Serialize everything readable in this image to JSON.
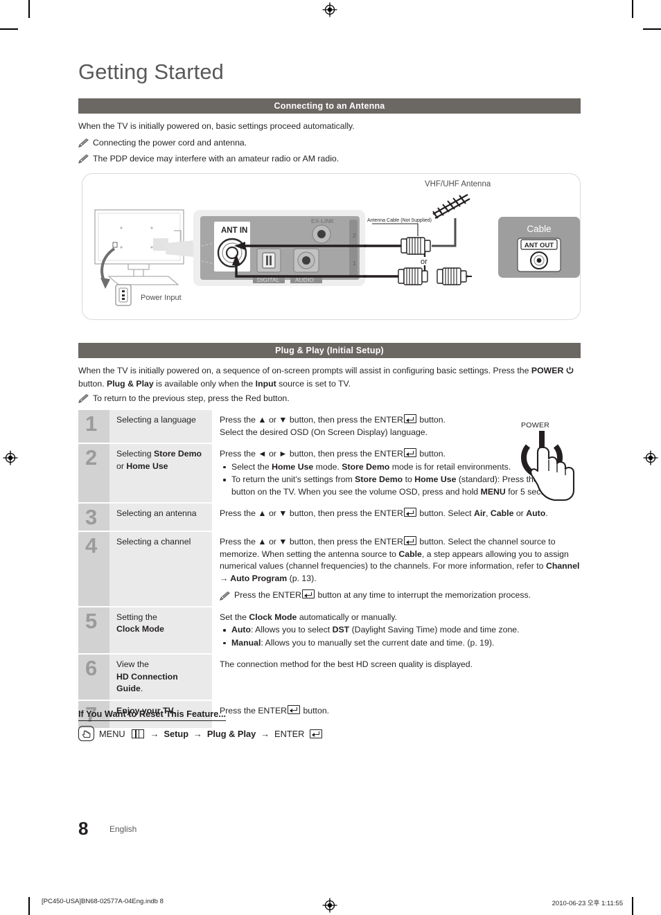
{
  "document": {
    "chapter_title": "Getting Started",
    "page_number": "8",
    "page_language": "English"
  },
  "sections": {
    "antenna": {
      "bar_title": "Connecting to an Antenna",
      "intro": "When the TV is initially powered on, basic settings proceed automatically.",
      "note_1": "Connecting the power cord and antenna.",
      "note_2": "The PDP device may interfere with an amateur radio or AM radio."
    },
    "plug_play": {
      "bar_title": "Plug & Play (Initial Setup)",
      "note": "To return to the previous step, press the Red button."
    }
  },
  "diagram": {
    "labels": {
      "vhf_uhf_antenna": "VHF/UHF Antenna",
      "antenna_cable": "Antenna Cable (Not Supplied)",
      "ant_in": "ANT IN",
      "ex_link": "EX-LINK",
      "digital": "DIGITAL",
      "audio": "AUDIO",
      "port_1": "1",
      "port_2": "2",
      "or": "or",
      "cable_box": "Cable",
      "ant_out": "ANT OUT",
      "power_input": "Power Input"
    }
  },
  "steps": [
    {
      "number": "1",
      "label_html": "Selecting a language",
      "desc_html": "Press the ▲ or ▼ button, then press the ENTER<span class=\"enterkey\"></span> button.<br>Select the desired OSD (On Screen Display) language."
    },
    {
      "number": "2",
      "label_html": "Selecting <b>Store Demo</b><br>or <b>Home Use</b>",
      "desc_html": "Press the ◄ or ► button, then press the ENTER<span class=\"enterkey\"></span> button.<ul class=\"bullets\"><li>Select the <b>Home Use</b> mode. <b>Store Demo</b> mode is for retail environments.</li><li>To return the unit’s settings from <b>Store Demo</b> to <b>Home Use</b> (standard): Press the volume button on the TV. When you see the volume OSD, press and hold <b>MENU</b> for 5 sec.</li></ul>"
    },
    {
      "number": "3",
      "label_html": "Selecting an antenna",
      "desc_html": "Press the ▲ or ▼ button, then press the ENTER<span class=\"enterkey\"></span> button. Select <b>Air</b>, <b>Cable</b> or <b>Auto</b>."
    },
    {
      "number": "4",
      "label_html": "Selecting a channel",
      "desc_html": "Press the ▲ or ▼ button, then press the ENTER<span class=\"enterkey\"></span> button. Select the channel source to memorize. When setting the antenna source to <b>Cable</b>, a step appears allowing you to assign numerical values (channel frequencies) to the channels. For more information, refer to <b>Channel → Auto Program</b> (p. 13).<div class=\"note-in\"><span class=\"pencil\"></span><span>Press the ENTER<span class=\"enterkey\"></span> button at any time to interrupt the memorization process.</span></div>"
    },
    {
      "number": "5",
      "label_html": "Setting the<br><b>Clock Mode</b>",
      "desc_html": "Set the <b>Clock Mode</b> automatically or manually.<ul class=\"bullets\"><li><b>Auto</b>: Allows you to select <b>DST</b> (Daylight Saving Time) mode and time zone.</li><li><b>Manual</b>: Allows you to manually set the current date and time. (p. 19).</li></ul>"
    },
    {
      "number": "6",
      "label_html": "View the<br><b>HD Connection Guide</b>.",
      "desc_html": "The connection method for the best HD screen quality is displayed."
    },
    {
      "number": "7",
      "label_html": "<b>Enjoy your TV.</b>",
      "desc_html": "Press the ENTER<span class=\"enterkey\"></span> button."
    }
  ],
  "power_figure": {
    "label": "POWER"
  },
  "reset": {
    "heading": "If You Want to Reset This Feature...",
    "path_menu": "MENU",
    "path_setup": "Setup",
    "path_plugplay": "Plug & Play",
    "path_enter": "ENTER",
    "arrow": "→"
  },
  "footer": {
    "file_name": "[PC450-USA]BN68-02577A-04Eng.indb   8",
    "timestamp": "2010-06-23   오후 1:11:55"
  },
  "colors": {
    "section_bar": "#6b6763",
    "step_number_bg": "#d2d2d2",
    "step_label_bg": "#eaeaea",
    "title_text": "#58595b",
    "body_text": "#231f20"
  }
}
